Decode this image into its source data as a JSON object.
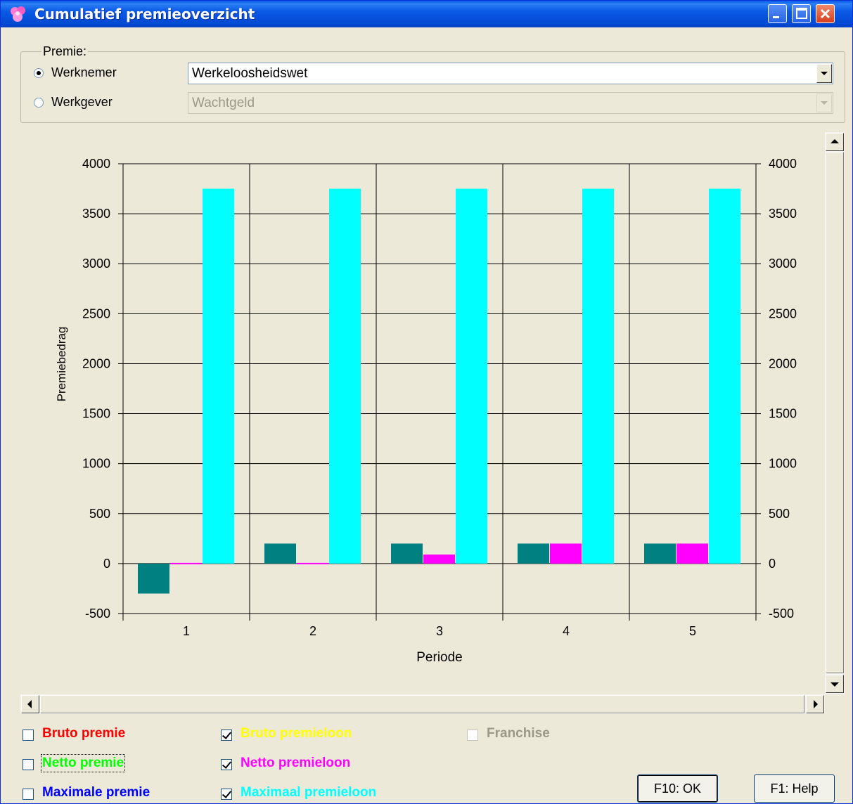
{
  "window": {
    "title": "Cumulatief premieoverzicht"
  },
  "premie": {
    "group_label": "Premie:",
    "options": [
      {
        "label": "Werknemer",
        "selected": true,
        "combo_value": "Werkeloosheidswet",
        "enabled": true
      },
      {
        "label": "Werkgever",
        "selected": false,
        "combo_value": "Wachtgeld",
        "enabled": false
      }
    ]
  },
  "chart_data": {
    "type": "bar",
    "categories": [
      "1",
      "2",
      "3",
      "4",
      "5"
    ],
    "xlabel": "Periode",
    "ylabel": "Premiebedrag",
    "ylim": [
      -500,
      4000
    ],
    "yticks": [
      -500,
      0,
      500,
      1000,
      1500,
      2000,
      2500,
      3000,
      3500,
      4000
    ],
    "secondary_axis": true,
    "grid": true,
    "series": [
      {
        "name": "Bruto premieloon",
        "color": "#008080",
        "values": [
          -300,
          200,
          200,
          200,
          200
        ]
      },
      {
        "name": "Netto premieloon",
        "color": "#ff00ff",
        "values": [
          0,
          0,
          90,
          200,
          200
        ]
      },
      {
        "name": "Maximaal premieloon",
        "color": "#00ffff",
        "values": [
          3750,
          3750,
          3750,
          3750,
          3750
        ]
      }
    ]
  },
  "options": {
    "col1": [
      {
        "label": "Bruto premie",
        "checked": false,
        "color": "#ff0000"
      },
      {
        "label": "Netto premie",
        "checked": false,
        "color": "#00ff00"
      },
      {
        "label": "Maximale premie",
        "checked": false,
        "color": "#0000ff"
      }
    ],
    "col2": [
      {
        "label": "Bruto premieloon",
        "checked": true,
        "color": "#ffff00"
      },
      {
        "label": "Netto premieloon",
        "checked": true,
        "color": "#ff00ff"
      },
      {
        "label": "Maximaal premieloon",
        "checked": true,
        "color": "#00ffff"
      }
    ],
    "franchise": {
      "label": "Franchise",
      "checked": false,
      "enabled": false
    }
  },
  "buttons": {
    "ok": "F10: OK",
    "help": "F1: Help"
  }
}
